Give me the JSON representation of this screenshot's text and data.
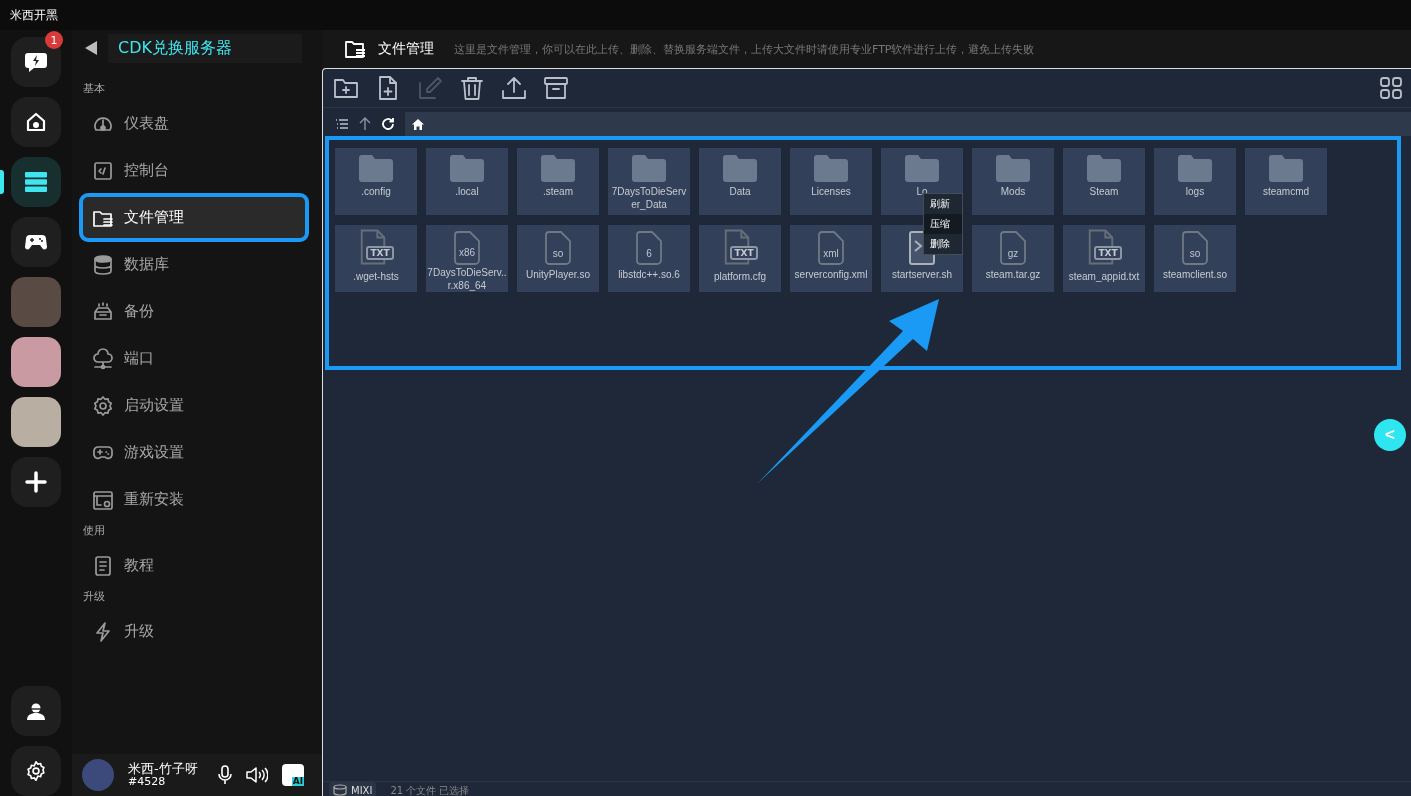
{
  "app_title": "米西开黑",
  "rail": {
    "badge": "1",
    "items": [
      {
        "kind": "chat",
        "selected": false
      },
      {
        "kind": "home",
        "selected": false
      },
      {
        "kind": "server",
        "selected": true
      },
      {
        "kind": "gamepad",
        "selected": false
      },
      {
        "kind": "photo",
        "selected": false
      },
      {
        "kind": "photo",
        "selected": false
      },
      {
        "kind": "photo",
        "selected": false
      },
      {
        "kind": "add",
        "selected": false
      }
    ],
    "bottom": [
      {
        "kind": "support"
      },
      {
        "kind": "settings"
      }
    ]
  },
  "server": {
    "name": "CDK兑换服务器"
  },
  "nav": [
    {
      "heading": "基本",
      "items": [
        {
          "label": "仪表盘",
          "kind": "gauge",
          "selected": false
        },
        {
          "label": "控制台",
          "kind": "console",
          "selected": false
        },
        {
          "label": "文件管理",
          "kind": "folder",
          "selected": true
        },
        {
          "label": "数据库",
          "kind": "database",
          "selected": false
        },
        {
          "label": "备份",
          "kind": "backup",
          "selected": false
        },
        {
          "label": "端口",
          "kind": "cloud",
          "selected": false
        },
        {
          "label": "启动设置",
          "kind": "gear",
          "selected": false
        },
        {
          "label": "游戏设置",
          "kind": "gamepad",
          "selected": false
        },
        {
          "label": "重新安装",
          "kind": "reinstall",
          "selected": false
        }
      ]
    },
    {
      "heading": "使用",
      "items": [
        {
          "label": "教程",
          "kind": "doc",
          "selected": false
        }
      ]
    },
    {
      "heading": "升级",
      "items": [
        {
          "label": "升级",
          "kind": "bolt",
          "selected": false
        }
      ]
    }
  ],
  "user": {
    "name": "米西-竹子呀",
    "tag": "#4528",
    "ai_label": "AI"
  },
  "page": {
    "title": "文件管理",
    "description": "这里是文件管理，你可以在此上传、删除、替换服务端文件，上传大文件时请使用专业FTP软件进行上传，避免上传失败"
  },
  "toolbar": [
    {
      "kind": "new-folder",
      "disabled": false
    },
    {
      "kind": "new-file",
      "disabled": false
    },
    {
      "kind": "edit",
      "disabled": true
    },
    {
      "kind": "delete",
      "disabled": false
    },
    {
      "kind": "upload",
      "disabled": false
    },
    {
      "kind": "archive",
      "disabled": false
    }
  ],
  "files": [
    {
      "name": ".config",
      "kind": "folder"
    },
    {
      "name": ".local",
      "kind": "folder"
    },
    {
      "name": ".steam",
      "kind": "folder"
    },
    {
      "name": "7DaysToDieServer_Data",
      "kind": "folder"
    },
    {
      "name": "Data",
      "kind": "folder"
    },
    {
      "name": "Licenses",
      "kind": "folder"
    },
    {
      "name": "Lo",
      "kind": "folder"
    },
    {
      "name": "Mods",
      "kind": "folder"
    },
    {
      "name": "Steam",
      "kind": "folder"
    },
    {
      "name": "logs",
      "kind": "folder"
    },
    {
      "name": "steamcmd",
      "kind": "folder"
    },
    {
      "name": ".wget-hsts",
      "kind": "txt",
      "ext": "TXT"
    },
    {
      "name": "7DaysToDieServ..r.x86_64",
      "kind": "file",
      "ext": "x86"
    },
    {
      "name": "UnityPlayer.so",
      "kind": "file",
      "ext": "so"
    },
    {
      "name": "libstdc++.so.6",
      "kind": "file",
      "ext": "6"
    },
    {
      "name": "platform.cfg",
      "kind": "txt",
      "ext": "TXT"
    },
    {
      "name": "serverconfig.xml",
      "kind": "file",
      "ext": "xml"
    },
    {
      "name": "startserver.sh",
      "kind": "terminal"
    },
    {
      "name": "steam.tar.gz",
      "kind": "file",
      "ext": "gz"
    },
    {
      "name": "steam_appid.txt",
      "kind": "txt",
      "ext": "TXT"
    },
    {
      "name": "steamclient.so",
      "kind": "file",
      "ext": "so"
    }
  ],
  "context_menu": [
    {
      "label": "刷新",
      "selected": false
    },
    {
      "label": "压缩",
      "selected": true
    },
    {
      "label": "删除",
      "selected": false
    }
  ],
  "status_bar": {
    "drive": "MIXI",
    "summary": "21 个文件 已选择"
  },
  "collapse_button": "<"
}
